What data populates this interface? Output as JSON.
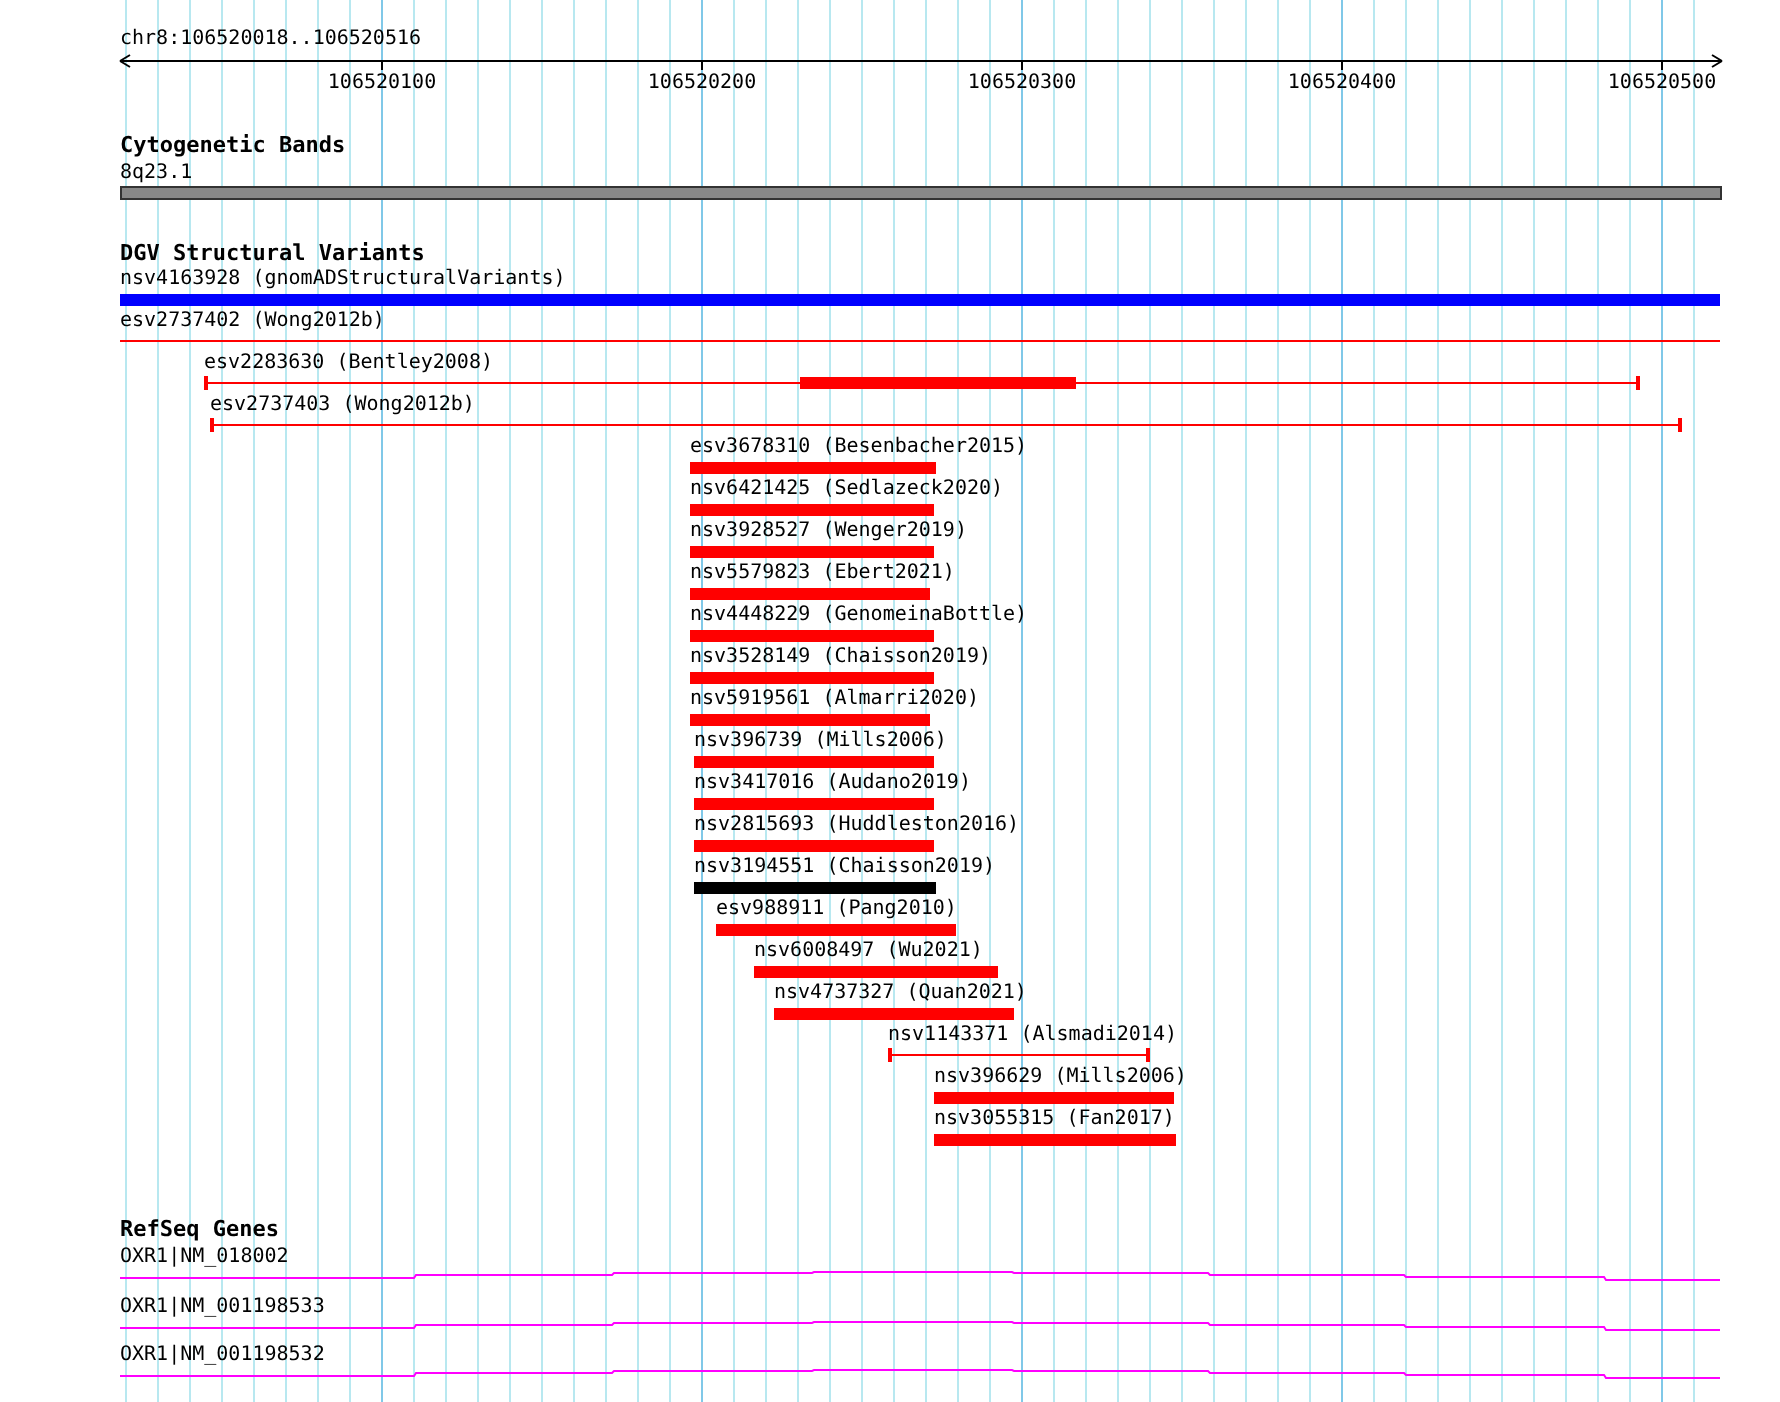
{
  "ruler": {
    "location": "chr8:106520018..106520516",
    "ticks": [
      "106520100",
      "106520200",
      "106520300",
      "106520400",
      "106520500"
    ]
  },
  "cytoband_track": {
    "title": "Cytogenetic Bands",
    "band": "8q23.1"
  },
  "variant_track": {
    "title": "DGV Structural Variants",
    "variants": [
      {
        "label": "nsv4163928 (gnomADStructuralVariants)",
        "kind": "bar",
        "color": "#0000ff"
      },
      {
        "label": "esv2737402 (Wong2012b)",
        "kind": "line",
        "color": "#ff0000"
      },
      {
        "label": "esv2283630 (Bentley2008)",
        "kind": "span-thick",
        "color": "#ff0000"
      },
      {
        "label": "esv2737403 (Wong2012b)",
        "kind": "span",
        "color": "#ff0000"
      },
      {
        "label": "esv3678310 (Besenbacher2015)",
        "kind": "bar",
        "color": "#ff0000"
      },
      {
        "label": "nsv6421425 (Sedlazeck2020)",
        "kind": "bar",
        "color": "#ff0000"
      },
      {
        "label": "nsv3928527 (Wenger2019)",
        "kind": "bar",
        "color": "#ff0000"
      },
      {
        "label": "nsv5579823 (Ebert2021)",
        "kind": "bar",
        "color": "#ff0000"
      },
      {
        "label": "nsv4448229 (GenomeinaBottle)",
        "kind": "bar",
        "color": "#ff0000"
      },
      {
        "label": "nsv3528149 (Chaisson2019)",
        "kind": "bar",
        "color": "#ff0000"
      },
      {
        "label": "nsv5919561 (Almarri2020)",
        "kind": "bar",
        "color": "#ff0000"
      },
      {
        "label": "nsv396739 (Mills2006)",
        "kind": "bar",
        "color": "#ff0000"
      },
      {
        "label": "nsv3417016 (Audano2019)",
        "kind": "bar",
        "color": "#ff0000"
      },
      {
        "label": "nsv2815693 (Huddleston2016)",
        "kind": "bar",
        "color": "#ff0000"
      },
      {
        "label": "nsv3194551 (Chaisson2019)",
        "kind": "bar",
        "color": "#000000"
      },
      {
        "label": "esv988911 (Pang2010)",
        "kind": "bar",
        "color": "#ff0000"
      },
      {
        "label": "nsv6008497 (Wu2021)",
        "kind": "bar",
        "color": "#ff0000"
      },
      {
        "label": "nsv4737327 (Quan2021)",
        "kind": "bar",
        "color": "#ff0000"
      },
      {
        "label": "nsv1143371 (Alsmadi2014)",
        "kind": "span",
        "color": "#ff0000"
      },
      {
        "label": "nsv396629 (Mills2006)",
        "kind": "bar",
        "color": "#ff0000"
      },
      {
        "label": "nsv3055315 (Fan2017)",
        "kind": "bar",
        "color": "#ff0000"
      }
    ]
  },
  "gene_track": {
    "title": "RefSeq Genes",
    "genes": [
      {
        "label": "OXR1|NM_018002"
      },
      {
        "label": "OXR1|NM_001198533"
      },
      {
        "label": "OXR1|NM_001198532"
      }
    ]
  }
}
